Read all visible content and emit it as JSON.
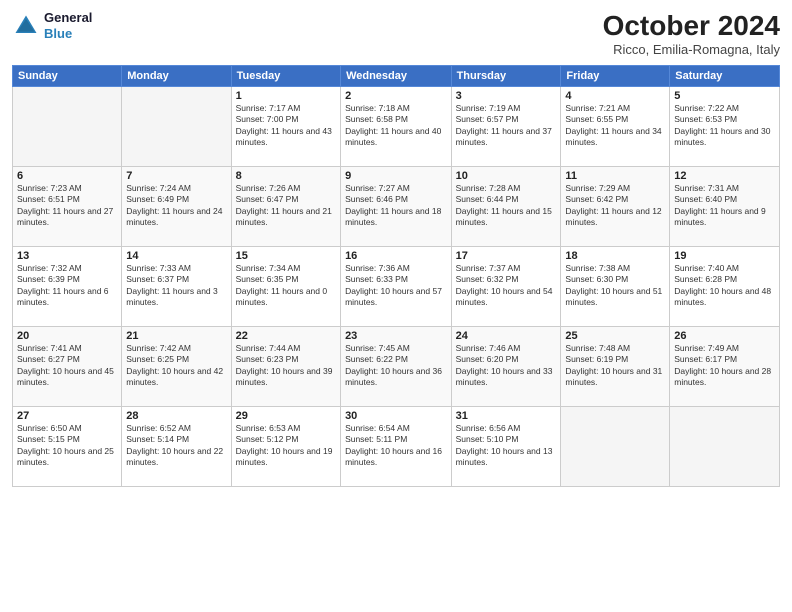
{
  "header": {
    "logo_line1": "General",
    "logo_line2": "Blue",
    "month": "October 2024",
    "location": "Ricco, Emilia-Romagna, Italy"
  },
  "weekdays": [
    "Sunday",
    "Monday",
    "Tuesday",
    "Wednesday",
    "Thursday",
    "Friday",
    "Saturday"
  ],
  "weeks": [
    [
      {
        "day": "",
        "sunrise": "",
        "sunset": "",
        "daylight": ""
      },
      {
        "day": "",
        "sunrise": "",
        "sunset": "",
        "daylight": ""
      },
      {
        "day": "1",
        "sunrise": "Sunrise: 7:17 AM",
        "sunset": "Sunset: 7:00 PM",
        "daylight": "Daylight: 11 hours and 43 minutes."
      },
      {
        "day": "2",
        "sunrise": "Sunrise: 7:18 AM",
        "sunset": "Sunset: 6:58 PM",
        "daylight": "Daylight: 11 hours and 40 minutes."
      },
      {
        "day": "3",
        "sunrise": "Sunrise: 7:19 AM",
        "sunset": "Sunset: 6:57 PM",
        "daylight": "Daylight: 11 hours and 37 minutes."
      },
      {
        "day": "4",
        "sunrise": "Sunrise: 7:21 AM",
        "sunset": "Sunset: 6:55 PM",
        "daylight": "Daylight: 11 hours and 34 minutes."
      },
      {
        "day": "5",
        "sunrise": "Sunrise: 7:22 AM",
        "sunset": "Sunset: 6:53 PM",
        "daylight": "Daylight: 11 hours and 30 minutes."
      }
    ],
    [
      {
        "day": "6",
        "sunrise": "Sunrise: 7:23 AM",
        "sunset": "Sunset: 6:51 PM",
        "daylight": "Daylight: 11 hours and 27 minutes."
      },
      {
        "day": "7",
        "sunrise": "Sunrise: 7:24 AM",
        "sunset": "Sunset: 6:49 PM",
        "daylight": "Daylight: 11 hours and 24 minutes."
      },
      {
        "day": "8",
        "sunrise": "Sunrise: 7:26 AM",
        "sunset": "Sunset: 6:47 PM",
        "daylight": "Daylight: 11 hours and 21 minutes."
      },
      {
        "day": "9",
        "sunrise": "Sunrise: 7:27 AM",
        "sunset": "Sunset: 6:46 PM",
        "daylight": "Daylight: 11 hours and 18 minutes."
      },
      {
        "day": "10",
        "sunrise": "Sunrise: 7:28 AM",
        "sunset": "Sunset: 6:44 PM",
        "daylight": "Daylight: 11 hours and 15 minutes."
      },
      {
        "day": "11",
        "sunrise": "Sunrise: 7:29 AM",
        "sunset": "Sunset: 6:42 PM",
        "daylight": "Daylight: 11 hours and 12 minutes."
      },
      {
        "day": "12",
        "sunrise": "Sunrise: 7:31 AM",
        "sunset": "Sunset: 6:40 PM",
        "daylight": "Daylight: 11 hours and 9 minutes."
      }
    ],
    [
      {
        "day": "13",
        "sunrise": "Sunrise: 7:32 AM",
        "sunset": "Sunset: 6:39 PM",
        "daylight": "Daylight: 11 hours and 6 minutes."
      },
      {
        "day": "14",
        "sunrise": "Sunrise: 7:33 AM",
        "sunset": "Sunset: 6:37 PM",
        "daylight": "Daylight: 11 hours and 3 minutes."
      },
      {
        "day": "15",
        "sunrise": "Sunrise: 7:34 AM",
        "sunset": "Sunset: 6:35 PM",
        "daylight": "Daylight: 11 hours and 0 minutes."
      },
      {
        "day": "16",
        "sunrise": "Sunrise: 7:36 AM",
        "sunset": "Sunset: 6:33 PM",
        "daylight": "Daylight: 10 hours and 57 minutes."
      },
      {
        "day": "17",
        "sunrise": "Sunrise: 7:37 AM",
        "sunset": "Sunset: 6:32 PM",
        "daylight": "Daylight: 10 hours and 54 minutes."
      },
      {
        "day": "18",
        "sunrise": "Sunrise: 7:38 AM",
        "sunset": "Sunset: 6:30 PM",
        "daylight": "Daylight: 10 hours and 51 minutes."
      },
      {
        "day": "19",
        "sunrise": "Sunrise: 7:40 AM",
        "sunset": "Sunset: 6:28 PM",
        "daylight": "Daylight: 10 hours and 48 minutes."
      }
    ],
    [
      {
        "day": "20",
        "sunrise": "Sunrise: 7:41 AM",
        "sunset": "Sunset: 6:27 PM",
        "daylight": "Daylight: 10 hours and 45 minutes."
      },
      {
        "day": "21",
        "sunrise": "Sunrise: 7:42 AM",
        "sunset": "Sunset: 6:25 PM",
        "daylight": "Daylight: 10 hours and 42 minutes."
      },
      {
        "day": "22",
        "sunrise": "Sunrise: 7:44 AM",
        "sunset": "Sunset: 6:23 PM",
        "daylight": "Daylight: 10 hours and 39 minutes."
      },
      {
        "day": "23",
        "sunrise": "Sunrise: 7:45 AM",
        "sunset": "Sunset: 6:22 PM",
        "daylight": "Daylight: 10 hours and 36 minutes."
      },
      {
        "day": "24",
        "sunrise": "Sunrise: 7:46 AM",
        "sunset": "Sunset: 6:20 PM",
        "daylight": "Daylight: 10 hours and 33 minutes."
      },
      {
        "day": "25",
        "sunrise": "Sunrise: 7:48 AM",
        "sunset": "Sunset: 6:19 PM",
        "daylight": "Daylight: 10 hours and 31 minutes."
      },
      {
        "day": "26",
        "sunrise": "Sunrise: 7:49 AM",
        "sunset": "Sunset: 6:17 PM",
        "daylight": "Daylight: 10 hours and 28 minutes."
      }
    ],
    [
      {
        "day": "27",
        "sunrise": "Sunrise: 6:50 AM",
        "sunset": "Sunset: 5:15 PM",
        "daylight": "Daylight: 10 hours and 25 minutes."
      },
      {
        "day": "28",
        "sunrise": "Sunrise: 6:52 AM",
        "sunset": "Sunset: 5:14 PM",
        "daylight": "Daylight: 10 hours and 22 minutes."
      },
      {
        "day": "29",
        "sunrise": "Sunrise: 6:53 AM",
        "sunset": "Sunset: 5:12 PM",
        "daylight": "Daylight: 10 hours and 19 minutes."
      },
      {
        "day": "30",
        "sunrise": "Sunrise: 6:54 AM",
        "sunset": "Sunset: 5:11 PM",
        "daylight": "Daylight: 10 hours and 16 minutes."
      },
      {
        "day": "31",
        "sunrise": "Sunrise: 6:56 AM",
        "sunset": "Sunset: 5:10 PM",
        "daylight": "Daylight: 10 hours and 13 minutes."
      },
      {
        "day": "",
        "sunrise": "",
        "sunset": "",
        "daylight": ""
      },
      {
        "day": "",
        "sunrise": "",
        "sunset": "",
        "daylight": ""
      }
    ]
  ]
}
